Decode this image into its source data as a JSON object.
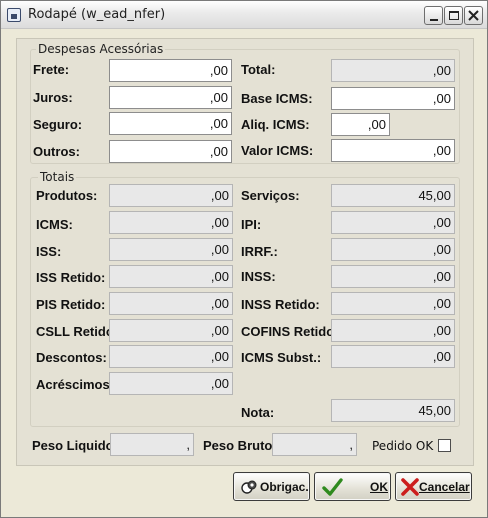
{
  "window": {
    "title": "Rodapé (w_ead_nfer)"
  },
  "despesas": {
    "group_title": "Despesas Acessórias",
    "frete_label": "Frete:",
    "frete_value": ",00",
    "juros_label": "Juros:",
    "juros_value": ",00",
    "seguro_label": "Seguro:",
    "seguro_value": ",00",
    "outros_label": "Outros:",
    "outros_value": ",00",
    "total_label": "Total:",
    "total_value": ",00",
    "base_icms_label": "Base ICMS:",
    "base_icms_value": ",00",
    "aliq_icms_label": "Aliq. ICMS:",
    "aliq_icms_value": ",00",
    "valor_icms_label": "Valor ICMS:",
    "valor_icms_value": ",00"
  },
  "totais": {
    "group_title": "Totais",
    "produtos_label": "Produtos:",
    "produtos_value": ",00",
    "icms_label": "ICMS:",
    "icms_value": ",00",
    "iss_label": "ISS:",
    "iss_value": ",00",
    "iss_retido_label": "ISS Retido:",
    "iss_retido_value": ",00",
    "pis_retido_label": "PIS Retido:",
    "pis_retido_value": ",00",
    "csll_retido_label": "CSLL Retido:",
    "csll_retido_value": ",00",
    "descontos_label": "Descontos:",
    "descontos_value": ",00",
    "acrescimos_label": "Acréscimos:",
    "acrescimos_value": ",00",
    "servicos_label": "Serviços:",
    "servicos_value": "45,00",
    "ipi_label": "IPI:",
    "ipi_value": ",00",
    "irrf_label": "IRRF.:",
    "irrf_value": ",00",
    "inss_label": "INSS:",
    "inss_value": ",00",
    "inss_retido_label": "INSS Retido:",
    "inss_retido_value": ",00",
    "cofins_retido_label": "COFINS Retido:",
    "cofins_retido_value": ",00",
    "icms_subst_label": "ICMS Subst.:",
    "icms_subst_value": ",00",
    "nota_label": "Nota:",
    "nota_value": "45,00"
  },
  "peso": {
    "liquido_label": "Peso Liquido:",
    "liquido_value": ",",
    "bruto_label": "Peso Bruto:",
    "bruto_value": ",",
    "pedido_ok_label": "Pedido OK",
    "pedido_ok_checked": false
  },
  "buttons": {
    "obrigac_label": "Obrigac.",
    "ok_label": "OK",
    "cancelar_label": "Cancelar"
  },
  "icons": {
    "app": "app-window-icon",
    "obrigac": "coins-icon",
    "ok": "checkmark-icon",
    "cancelar": "x-cancel-icon"
  },
  "colors": {
    "ok_check": "#2f8a1e",
    "cancel_x": "#cc1d1d"
  }
}
